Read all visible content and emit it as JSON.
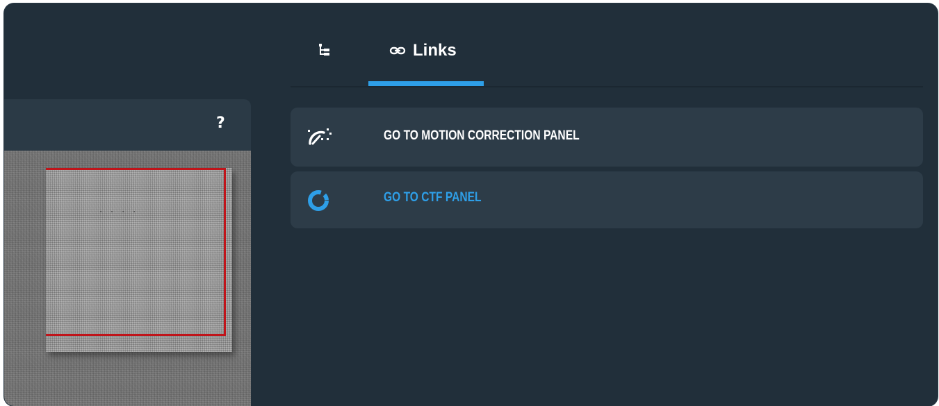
{
  "help_button": {
    "label": "?"
  },
  "tabs": [
    {
      "icon": "tree-icon",
      "label": ""
    },
    {
      "icon": "link-icon",
      "label": "Links"
    }
  ],
  "active_tab": "Links",
  "links": [
    {
      "icon": "speedometer-icon",
      "label": "GO TO MOTION CORRECTION PANEL",
      "color": "#ffffff"
    },
    {
      "icon": "donut-icon",
      "label": "GO TO CTF PANEL",
      "color": "#2e9fe8"
    }
  ],
  "colors": {
    "background": "#212f3a",
    "card": "#2d3c48",
    "accent": "#2e9fe8",
    "crop_rect": "#c0141a"
  }
}
